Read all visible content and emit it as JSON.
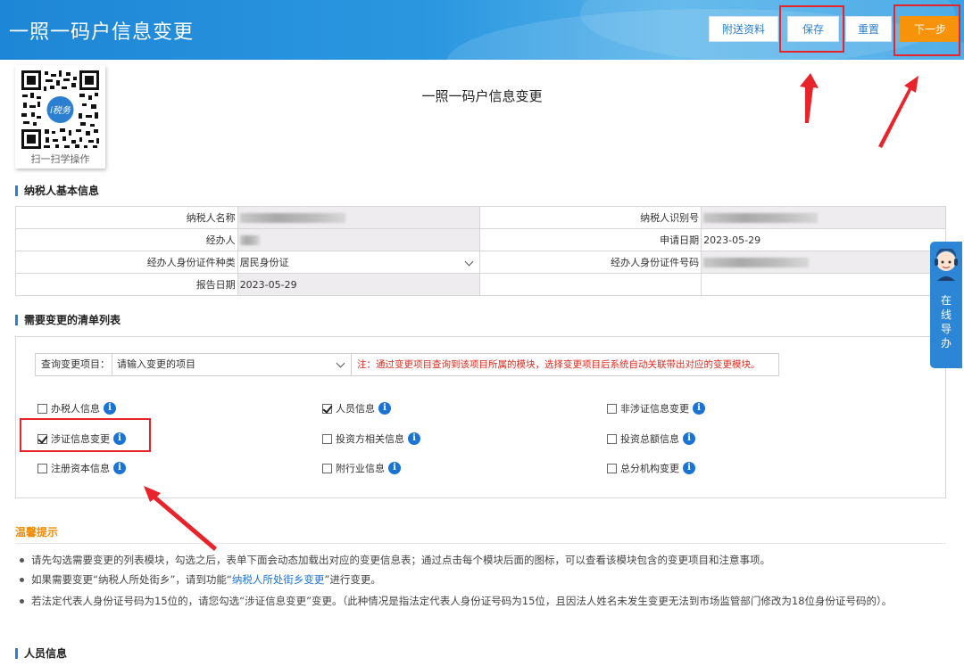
{
  "header": {
    "title": "一照一码户信息变更",
    "buttons": {
      "attach": "附送资料",
      "save": "保存",
      "reset": "重置",
      "next": "下一步"
    }
  },
  "qr": {
    "label": "扫一扫学操作",
    "logo_text": "i税务"
  },
  "page_title": "一照一码户信息变更",
  "basic_section": {
    "title": "纳税人基本信息",
    "rows": [
      {
        "label1": "纳税人名称",
        "value1": "",
        "label2": "纳税人识别号",
        "value2": ""
      },
      {
        "label1": "经办人",
        "value1": "",
        "label2": "申请日期",
        "value2": "2023-05-29"
      },
      {
        "label1": "经办人身份证件种类",
        "value1": "居民身份证",
        "label2": "经办人身份证件号码",
        "value2": ""
      },
      {
        "label1": "报告日期",
        "value1": "2023-05-29",
        "label2": "",
        "value2": ""
      }
    ]
  },
  "change_section": {
    "title": "需要变更的清单列表",
    "query_label": "查询变更项目：",
    "query_placeholder": "请输入变更的项目",
    "query_note": "注：通过变更项目查询到该项目所属的模块，选择变更项目后系统自动关联带出对应的变更模块。",
    "items": [
      {
        "label": "办税人信息",
        "checked": false
      },
      {
        "label": "人员信息",
        "checked": true
      },
      {
        "label": "非涉证信息变更",
        "checked": false
      },
      {
        "label": "涉证信息变更",
        "checked": true
      },
      {
        "label": "投资方相关信息",
        "checked": false
      },
      {
        "label": "投资总额信息",
        "checked": false
      },
      {
        "label": "注册资本信息",
        "checked": false
      },
      {
        "label": "附行业信息",
        "checked": false
      },
      {
        "label": "总分机构变更",
        "checked": false
      }
    ]
  },
  "tips": {
    "title": "温馨提示",
    "items": [
      "请先勾选需要变更的列表模块，勾选之后，表单下面会动态加载出对应的变更信息表；通过点击每个模块后面的图标，可以查看该模块包含的变更项目和注意事项。",
      {
        "before": "如果需要变更“纳税人所处街乡”，请到功能“",
        "link": "纳税人所处街乡变更",
        "after": "”进行变更。"
      },
      "若法定代表人身份证号码为15位的，请您勾选“涉证信息变更”变更。（此种情况是指法定代表人身份证号码为15位，且因法人姓名未发生变更无法到市场监管部门修改为18位身份证号码的）。"
    ]
  },
  "person_section": {
    "title": "人员信息"
  },
  "guide": {
    "label": "在线导办"
  },
  "icons": {
    "info": "info-icon",
    "dropdown": "chevron-down-icon",
    "guide": "robot-avatar-icon"
  },
  "colors": {
    "header": "#2b97e0",
    "next_button": "#f7920b",
    "highlight": "#e8232a",
    "link": "#1a74d8",
    "note": "#e1281c"
  }
}
